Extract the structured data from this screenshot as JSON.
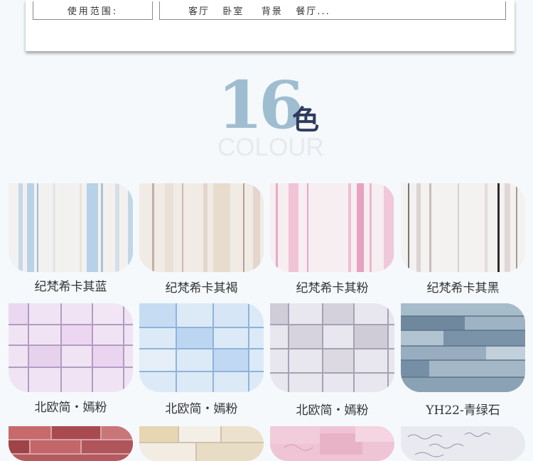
{
  "spec": {
    "label": "使用范围:",
    "value": "客厅   卧室    背景   餐厅..."
  },
  "heading": {
    "number": "16",
    "char": "色",
    "subtitle": "COLOUR"
  },
  "swatches": [
    {
      "name": "纪梵希卡其蓝"
    },
    {
      "name": "纪梵希卡其褐"
    },
    {
      "name": "纪梵希卡其粉"
    },
    {
      "name": "纪梵希卡其黑"
    },
    {
      "name": "北欧简・嫣粉"
    },
    {
      "name": "北欧简・嫣粉"
    },
    {
      "name": "北欧简・嫣粉"
    },
    {
      "name": "YH22-青绿石"
    }
  ],
  "colors": {
    "heading_number": "#9fbdd0",
    "heading_char": "#2f3a5e",
    "background": "#f5f9fc"
  }
}
